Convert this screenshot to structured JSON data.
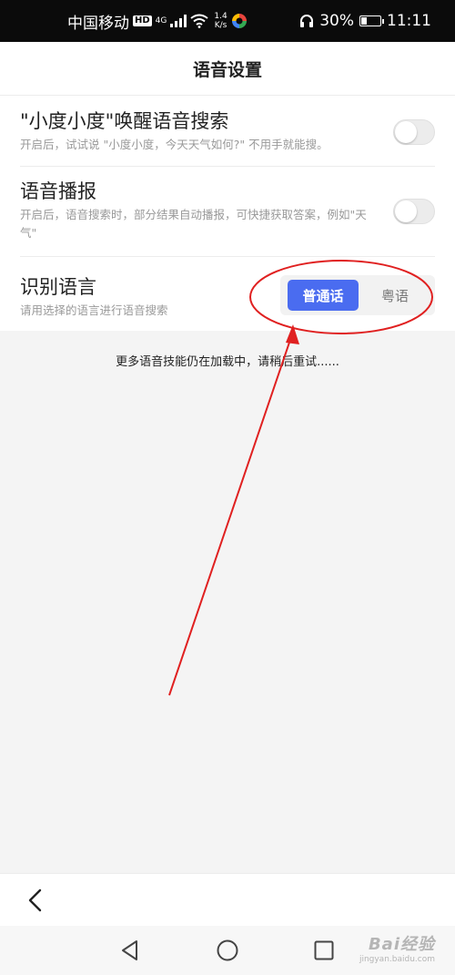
{
  "status_bar": {
    "carrier": "中国移动",
    "hd_badge": "HD",
    "network_type": "4G",
    "net_speed_value": "1.4",
    "net_speed_unit": "K/s",
    "battery_percent": "30%",
    "battery_level": 0.3,
    "time": "11:11"
  },
  "header": {
    "title": "语音设置"
  },
  "settings": {
    "wake_search": {
      "title": "\"小度小度\"唤醒语音搜索",
      "desc": "开启后，试试说 \"小度小度，今天天气如何?\" 不用手就能搜。",
      "enabled": false
    },
    "voice_broadcast": {
      "title": "语音播报",
      "desc": "开启后，语音搜索时，部分结果自动播报，可快捷获取答案，例如\"天气\"",
      "enabled": false
    },
    "recognition_language": {
      "title": "识别语言",
      "desc": "请用选择的语言进行语音搜索",
      "options": [
        "普通话",
        "粤语"
      ],
      "selected": "普通话"
    }
  },
  "loading_message": "更多语音技能仍在加载中，请稍后重试......",
  "colors": {
    "accent": "#4a6cf0",
    "annotation": "#e02020"
  },
  "icons": {
    "back": "chevron-left-icon",
    "nav_back": "triangle-back-icon",
    "nav_home": "circle-home-icon",
    "nav_recent": "square-recent-icon"
  },
  "watermark": {
    "brand": "Bai经验",
    "url": "jingyan.baidu.com"
  }
}
